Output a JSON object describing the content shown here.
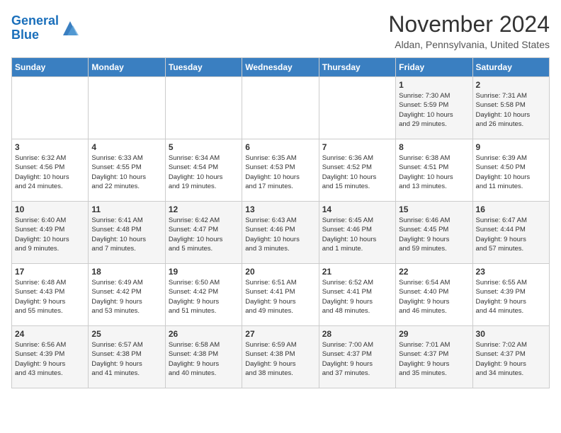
{
  "logo": {
    "line1": "General",
    "line2": "Blue"
  },
  "header": {
    "title": "November 2024",
    "subtitle": "Aldan, Pennsylvania, United States"
  },
  "days_of_week": [
    "Sunday",
    "Monday",
    "Tuesday",
    "Wednesday",
    "Thursday",
    "Friday",
    "Saturday"
  ],
  "weeks": [
    [
      {
        "day": "",
        "info": ""
      },
      {
        "day": "",
        "info": ""
      },
      {
        "day": "",
        "info": ""
      },
      {
        "day": "",
        "info": ""
      },
      {
        "day": "",
        "info": ""
      },
      {
        "day": "1",
        "info": "Sunrise: 7:30 AM\nSunset: 5:59 PM\nDaylight: 10 hours\nand 29 minutes."
      },
      {
        "day": "2",
        "info": "Sunrise: 7:31 AM\nSunset: 5:58 PM\nDaylight: 10 hours\nand 26 minutes."
      }
    ],
    [
      {
        "day": "3",
        "info": "Sunrise: 6:32 AM\nSunset: 4:56 PM\nDaylight: 10 hours\nand 24 minutes."
      },
      {
        "day": "4",
        "info": "Sunrise: 6:33 AM\nSunset: 4:55 PM\nDaylight: 10 hours\nand 22 minutes."
      },
      {
        "day": "5",
        "info": "Sunrise: 6:34 AM\nSunset: 4:54 PM\nDaylight: 10 hours\nand 19 minutes."
      },
      {
        "day": "6",
        "info": "Sunrise: 6:35 AM\nSunset: 4:53 PM\nDaylight: 10 hours\nand 17 minutes."
      },
      {
        "day": "7",
        "info": "Sunrise: 6:36 AM\nSunset: 4:52 PM\nDaylight: 10 hours\nand 15 minutes."
      },
      {
        "day": "8",
        "info": "Sunrise: 6:38 AM\nSunset: 4:51 PM\nDaylight: 10 hours\nand 13 minutes."
      },
      {
        "day": "9",
        "info": "Sunrise: 6:39 AM\nSunset: 4:50 PM\nDaylight: 10 hours\nand 11 minutes."
      }
    ],
    [
      {
        "day": "10",
        "info": "Sunrise: 6:40 AM\nSunset: 4:49 PM\nDaylight: 10 hours\nand 9 minutes."
      },
      {
        "day": "11",
        "info": "Sunrise: 6:41 AM\nSunset: 4:48 PM\nDaylight: 10 hours\nand 7 minutes."
      },
      {
        "day": "12",
        "info": "Sunrise: 6:42 AM\nSunset: 4:47 PM\nDaylight: 10 hours\nand 5 minutes."
      },
      {
        "day": "13",
        "info": "Sunrise: 6:43 AM\nSunset: 4:46 PM\nDaylight: 10 hours\nand 3 minutes."
      },
      {
        "day": "14",
        "info": "Sunrise: 6:45 AM\nSunset: 4:46 PM\nDaylight: 10 hours\nand 1 minute."
      },
      {
        "day": "15",
        "info": "Sunrise: 6:46 AM\nSunset: 4:45 PM\nDaylight: 9 hours\nand 59 minutes."
      },
      {
        "day": "16",
        "info": "Sunrise: 6:47 AM\nSunset: 4:44 PM\nDaylight: 9 hours\nand 57 minutes."
      }
    ],
    [
      {
        "day": "17",
        "info": "Sunrise: 6:48 AM\nSunset: 4:43 PM\nDaylight: 9 hours\nand 55 minutes."
      },
      {
        "day": "18",
        "info": "Sunrise: 6:49 AM\nSunset: 4:42 PM\nDaylight: 9 hours\nand 53 minutes."
      },
      {
        "day": "19",
        "info": "Sunrise: 6:50 AM\nSunset: 4:42 PM\nDaylight: 9 hours\nand 51 minutes."
      },
      {
        "day": "20",
        "info": "Sunrise: 6:51 AM\nSunset: 4:41 PM\nDaylight: 9 hours\nand 49 minutes."
      },
      {
        "day": "21",
        "info": "Sunrise: 6:52 AM\nSunset: 4:41 PM\nDaylight: 9 hours\nand 48 minutes."
      },
      {
        "day": "22",
        "info": "Sunrise: 6:54 AM\nSunset: 4:40 PM\nDaylight: 9 hours\nand 46 minutes."
      },
      {
        "day": "23",
        "info": "Sunrise: 6:55 AM\nSunset: 4:39 PM\nDaylight: 9 hours\nand 44 minutes."
      }
    ],
    [
      {
        "day": "24",
        "info": "Sunrise: 6:56 AM\nSunset: 4:39 PM\nDaylight: 9 hours\nand 43 minutes."
      },
      {
        "day": "25",
        "info": "Sunrise: 6:57 AM\nSunset: 4:38 PM\nDaylight: 9 hours\nand 41 minutes."
      },
      {
        "day": "26",
        "info": "Sunrise: 6:58 AM\nSunset: 4:38 PM\nDaylight: 9 hours\nand 40 minutes."
      },
      {
        "day": "27",
        "info": "Sunrise: 6:59 AM\nSunset: 4:38 PM\nDaylight: 9 hours\nand 38 minutes."
      },
      {
        "day": "28",
        "info": "Sunrise: 7:00 AM\nSunset: 4:37 PM\nDaylight: 9 hours\nand 37 minutes."
      },
      {
        "day": "29",
        "info": "Sunrise: 7:01 AM\nSunset: 4:37 PM\nDaylight: 9 hours\nand 35 minutes."
      },
      {
        "day": "30",
        "info": "Sunrise: 7:02 AM\nSunset: 4:37 PM\nDaylight: 9 hours\nand 34 minutes."
      }
    ]
  ]
}
